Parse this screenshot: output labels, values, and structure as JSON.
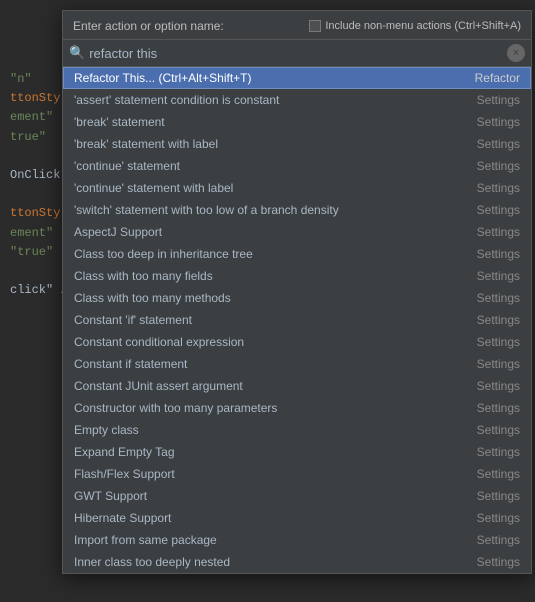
{
  "codeBg": {
    "lines": [
      {
        "text": "\"n\"",
        "class": "code-green"
      },
      {
        "text": "ttonStyle",
        "class": "code-orange"
      },
      {
        "text": "ement\"",
        "class": "code-green"
      },
      {
        "text": "true\"",
        "class": "code-green"
      },
      {
        "text": "",
        "class": "code-white"
      },
      {
        "text": "OnClick\" /",
        "class": "code-white"
      },
      {
        "text": "",
        "class": "code-white"
      },
      {
        "text": "ttonStyle",
        "class": "code-orange"
      },
      {
        "text": "ement\"",
        "class": "code-green"
      },
      {
        "text": "\"true\"",
        "class": "code-green"
      },
      {
        "text": "",
        "class": "code-white"
      },
      {
        "text": "click\" />",
        "class": "code-white"
      }
    ]
  },
  "dialog": {
    "header": {
      "label": "Enter action or option name:",
      "checkbox_label": "Include non-menu actions (Ctrl+Shift+A)"
    },
    "search": {
      "placeholder": "refactor this",
      "value": "refactor this",
      "clear_icon": "×"
    },
    "list": {
      "items": [
        {
          "name": "Refactor This... (Ctrl+Alt+Shift+T)",
          "category": "Refactor",
          "selected": true
        },
        {
          "name": "'assert' statement condition is constant",
          "category": "Settings",
          "selected": false
        },
        {
          "name": "'break' statement",
          "category": "Settings",
          "selected": false
        },
        {
          "name": "'break' statement with label",
          "category": "Settings",
          "selected": false
        },
        {
          "name": "'continue' statement",
          "category": "Settings",
          "selected": false
        },
        {
          "name": "'continue' statement with label",
          "category": "Settings",
          "selected": false
        },
        {
          "name": "'switch' statement with too low of a branch density",
          "category": "Settings",
          "selected": false
        },
        {
          "name": "AspectJ Support",
          "category": "Settings",
          "selected": false
        },
        {
          "name": "Class too deep in inheritance tree",
          "category": "Settings",
          "selected": false
        },
        {
          "name": "Class with too many fields",
          "category": "Settings",
          "selected": false
        },
        {
          "name": "Class with too many methods",
          "category": "Settings",
          "selected": false
        },
        {
          "name": "Constant 'if' statement",
          "category": "Settings",
          "selected": false
        },
        {
          "name": "Constant conditional expression",
          "category": "Settings",
          "selected": false
        },
        {
          "name": "Constant if statement",
          "category": "Settings",
          "selected": false
        },
        {
          "name": "Constant JUnit assert argument",
          "category": "Settings",
          "selected": false
        },
        {
          "name": "Constructor with too many parameters",
          "category": "Settings",
          "selected": false
        },
        {
          "name": "Empty class",
          "category": "Settings",
          "selected": false
        },
        {
          "name": "Expand Empty Tag",
          "category": "Settings",
          "selected": false
        },
        {
          "name": "Flash/Flex Support",
          "category": "Settings",
          "selected": false
        },
        {
          "name": "GWT Support",
          "category": "Settings",
          "selected": false
        },
        {
          "name": "Hibernate Support",
          "category": "Settings",
          "selected": false
        },
        {
          "name": "Import from same package",
          "category": "Settings",
          "selected": false
        },
        {
          "name": "Inner class too deeply nested",
          "category": "Settings",
          "selected": false
        }
      ]
    }
  }
}
